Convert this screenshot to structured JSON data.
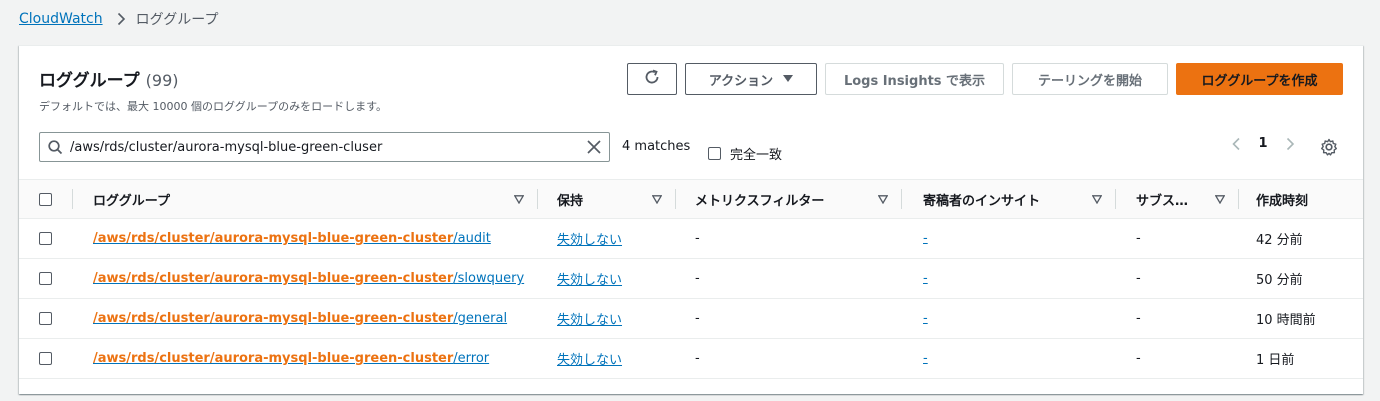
{
  "breadcrumb": {
    "root": "CloudWatch",
    "current": "ロググループ"
  },
  "header": {
    "title": "ロググループ",
    "count": "(99)",
    "description": "デフォルトでは、最大 10000 個のロググループのみをロードします。"
  },
  "toolbar": {
    "actions_label": "アクション",
    "insights_label": "Logs Insights で表示",
    "tail_label": "テーリングを開始",
    "create_label": "ロググループを作成"
  },
  "search": {
    "value": "/aws/rds/cluster/aurora-mysql-blue-green-cluser",
    "matches": "4 matches",
    "exact_label": "完全一致"
  },
  "pagination": {
    "page": "1"
  },
  "table": {
    "columns": [
      "ロググループ",
      "保持",
      "メトリクスフィルター",
      "寄稿者のインサイト",
      "サブス…",
      "作成時刻"
    ],
    "rows": [
      {
        "prefix": "/aws/rds/cluster/aurora-mysql-blue-green-clust",
        "mid": "er",
        "suffix": "/audit",
        "retention": "失効しない",
        "metric_filter": "-",
        "contributor": "-",
        "subscription": "-",
        "created": "42 分前"
      },
      {
        "prefix": "/aws/rds/cluster/aurora-mysql-blue-green-clust",
        "mid": "er",
        "suffix": "/slowquery",
        "retention": "失効しない",
        "metric_filter": "-",
        "contributor": "-",
        "subscription": "-",
        "created": "50 分前"
      },
      {
        "prefix": "/aws/rds/cluster/aurora-mysql-blue-green-clust",
        "mid": "er",
        "suffix": "/general",
        "retention": "失効しない",
        "metric_filter": "-",
        "contributor": "-",
        "subscription": "-",
        "created": "10 時間前"
      },
      {
        "prefix": "/aws/rds/cluster/aurora-mysql-blue-green-clust",
        "mid": "er",
        "suffix": "/error",
        "retention": "失効しない",
        "metric_filter": "-",
        "contributor": "-",
        "subscription": "-",
        "created": "1 日前"
      }
    ]
  },
  "colors": {
    "link": "#0073bb",
    "primary": "#ec7211",
    "highlight": "#ec7211"
  },
  "icons": [
    "chevron-right-icon",
    "refresh-icon",
    "caret-down-icon",
    "search-icon",
    "close-icon",
    "chevron-left-icon",
    "settings-gear-icon",
    "sort-caret-icon"
  ]
}
